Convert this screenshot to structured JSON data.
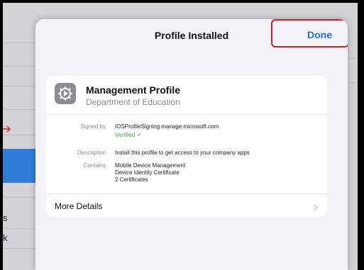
{
  "modal": {
    "title": "Profile Installed",
    "done_label": "Done"
  },
  "profile": {
    "name": "Management Profile",
    "organization": "Department of Education",
    "icon": "gear-icon"
  },
  "details": {
    "signed_by_label": "Signed by",
    "signed_by_value": "IOSProfileSigning.manage.microsoft.com",
    "verified_text": "Verified ✓",
    "description_label": "Description",
    "description_value": "Install this profile to get access to your company apps",
    "contains_label": "Contains",
    "contains_items": [
      "Mobile Device Management",
      "Device Identity Certificate",
      "2 Certificates"
    ]
  },
  "more_details_label": "More Details",
  "background_fragments": {
    "item_1": "s",
    "item_2": "k"
  },
  "colors": {
    "accent": "#1d6fd8",
    "highlight": "#d81f1f",
    "verified": "#3aa846"
  }
}
